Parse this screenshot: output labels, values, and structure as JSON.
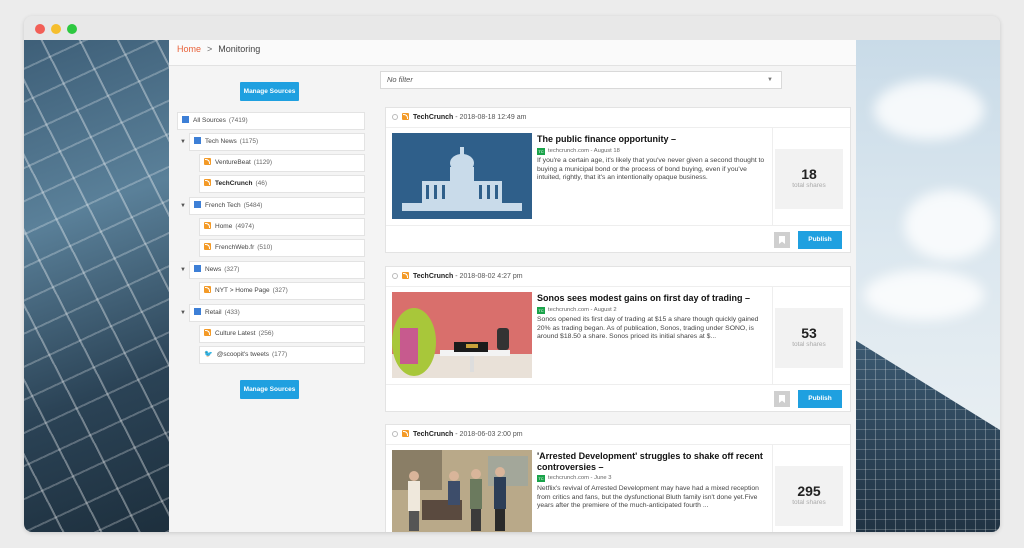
{
  "breadcrumb": {
    "home": "Home",
    "separator": ">",
    "current": "Monitoring"
  },
  "sidebar": {
    "manage_label": "Manage Sources",
    "sources": [
      {
        "label": "All Sources",
        "count": "(7419)",
        "icon": "folder-icon",
        "bold": false
      },
      {
        "label": "Tech News",
        "count": "(1175)",
        "icon": "folder-icon",
        "bold": false
      },
      {
        "label": "VentureBeat",
        "count": "(1129)",
        "icon": "rss-icon",
        "bold": false
      },
      {
        "label": "TechCrunch",
        "count": "(46)",
        "icon": "rss-icon",
        "bold": true
      },
      {
        "label": "French Tech",
        "count": "(5484)",
        "icon": "folder-icon",
        "bold": false
      },
      {
        "label": "Home",
        "count": "(4974)",
        "icon": "rss-icon",
        "bold": false
      },
      {
        "label": "FrenchWeb.fr",
        "count": "(510)",
        "icon": "rss-icon",
        "bold": false
      },
      {
        "label": "News",
        "count": "(327)",
        "icon": "folder-icon",
        "bold": false
      },
      {
        "label": "NYT > Home Page",
        "count": "(327)",
        "icon": "rss-icon",
        "bold": false
      },
      {
        "label": "Retail",
        "count": "(433)",
        "icon": "folder-icon",
        "bold": false
      },
      {
        "label": "Culture Latest",
        "count": "(256)",
        "icon": "rss-icon",
        "bold": false
      },
      {
        "label": "@scoopit's tweets",
        "count": "(177)",
        "icon": "twitter-icon",
        "bold": false
      }
    ]
  },
  "filter": {
    "value": "No filter"
  },
  "articles": [
    {
      "source": "TechCrunch",
      "datetime": " - 2018-08-18 12:49 am",
      "title": "The public finance opportunity –",
      "site": "techcrunch.com - August 18",
      "excerpt": "If you're a certain age, it's likely that you've never given a second thought to buying a municipal bond or the process of bond buying, even if you've intuited, rightly, that it's an intentionally opaque business.",
      "shares": "18",
      "shares_label": "total shares",
      "publish": "Publish"
    },
    {
      "source": "TechCrunch",
      "datetime": " - 2018-08-02 4:27 pm",
      "title": "Sonos sees modest gains on first day of trading –",
      "site": "techcrunch.com - August 2",
      "excerpt": "Sonos opened its first day of trading at $15 a share though quickly gained 20% as trading began. As of publication, Sonos, trading under SONO, is around $18.50 a share. Sonos priced its initial shares at $...",
      "shares": "53",
      "shares_label": "total shares",
      "publish": "Publish"
    },
    {
      "source": "TechCrunch",
      "datetime": " - 2018-06-03 2:00 pm",
      "title": "'Arrested Development' struggles to shake off recent controversies –",
      "site": "techcrunch.com - June 3",
      "excerpt": "Netflix's revival of Arrested Development may have had a mixed reception from critics and fans, but the dysfunctional Bluth family isn't done yet.Five years after the premiere of the much-anticipated fourth ...",
      "shares": "295",
      "shares_label": "total shares",
      "publish": "Publish"
    }
  ]
}
